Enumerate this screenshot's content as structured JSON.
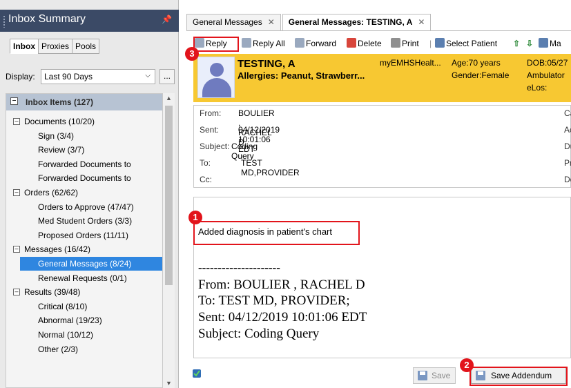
{
  "left_panel": {
    "title": "Inbox Summary",
    "pin_icon": "📌",
    "tabs": [
      "Inbox",
      "Proxies",
      "Pools"
    ],
    "display_label": "Display:",
    "display_value": "Last 90 Days",
    "more_label": "...",
    "tree_header": "Inbox Items (127)",
    "tree": [
      {
        "label": "Documents (10/20)",
        "level": 0,
        "expanded": true
      },
      {
        "label": "Sign (3/4)",
        "level": 1
      },
      {
        "label": "Review (3/7)",
        "level": 1
      },
      {
        "label": "Forwarded Documents to",
        "level": 1
      },
      {
        "label": "Forwarded Documents to",
        "level": 1
      },
      {
        "label": "Orders (62/62)",
        "level": 0,
        "expanded": true
      },
      {
        "label": "Orders to Approve (47/47)",
        "level": 1
      },
      {
        "label": "Med Student Orders (3/3)",
        "level": 1
      },
      {
        "label": "Proposed Orders (11/11)",
        "level": 1
      },
      {
        "label": "Messages (16/42)",
        "level": 0,
        "expanded": true
      },
      {
        "label": "General Messages (8/24)",
        "level": 1,
        "selected": true
      },
      {
        "label": "Renewal Requests (0/1)",
        "level": 1
      },
      {
        "label": "Results (39/48)",
        "level": 0,
        "expanded": true
      },
      {
        "label": "Critical (8/10)",
        "level": 1
      },
      {
        "label": "Abnormal (19/23)",
        "level": 1
      },
      {
        "label": "Normal (10/12)",
        "level": 1
      },
      {
        "label": "Other (2/3)",
        "level": 1
      }
    ]
  },
  "tabs": [
    {
      "label": "General Messages",
      "active": false
    },
    {
      "label": "General Messages: TESTING, A",
      "active": true
    }
  ],
  "toolbar": {
    "reply": "Reply",
    "reply_all": "Reply All",
    "forward": "Forward",
    "delete": "Delete",
    "print": "Print",
    "select_patient": "Select Patient",
    "more": "Ma"
  },
  "patient": {
    "name": "TESTING, A",
    "allergies": "Allergies: Peanut, Strawberr...",
    "portal": "myEMHSHealt...",
    "age": "Age:70 years",
    "dob": "DOB:05/27",
    "gender": "Gender:Female",
    "ambulatory": "Ambulator",
    "elos": "eLos:"
  },
  "message": {
    "from_label": "From:",
    "from": "BOULIER , RACHEL D",
    "sent_label": "Sent:",
    "sent": "04/12/2019 10:01:06 EDT",
    "subject_label": "Subject:",
    "subject": "Coding Query",
    "to_label": "To:",
    "to": "TEST MD,PROVIDER",
    "cc_label": "Cc:",
    "right_labels": [
      "Caller:",
      "Action",
      "Due:",
      "Provid",
      "Docum"
    ]
  },
  "body": {
    "note": "Added diagnosis in patient's chart",
    "dashes": "---------------------",
    "lines": [
      "From: BOULIER , RACHEL D",
      "To: TEST MD, PROVIDER;",
      "Sent: 04/12/2019 10:01:06 EDT",
      "Subject: Coding Query"
    ]
  },
  "buttons": {
    "save": "Save",
    "save_addendum": "Save Addendum"
  },
  "badges": [
    "1",
    "2",
    "3"
  ],
  "colors": {
    "header_bg": "#3b4a66",
    "banner_bg": "#f7c832",
    "selected_bg": "#2f86e0",
    "annotation_red": "#e2141b"
  }
}
